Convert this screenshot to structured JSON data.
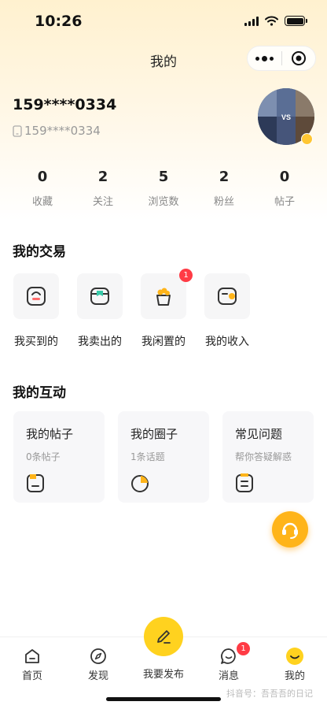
{
  "status": {
    "time": "10:26"
  },
  "nav": {
    "title": "我的"
  },
  "profile": {
    "phone_masked": "159****0334",
    "phone_sub": "159****0334"
  },
  "stats": [
    {
      "value": "0",
      "label": "收藏"
    },
    {
      "value": "2",
      "label": "关注"
    },
    {
      "value": "5",
      "label": "浏览数"
    },
    {
      "value": "2",
      "label": "粉丝"
    },
    {
      "value": "0",
      "label": "帖子"
    }
  ],
  "trade": {
    "title": "我的交易",
    "items": [
      {
        "label": "我买到的",
        "icon": "bought-icon"
      },
      {
        "label": "我卖出的",
        "icon": "sold-icon"
      },
      {
        "label": "我闲置的",
        "icon": "idle-icon",
        "badge": "1"
      },
      {
        "label": "我的收入",
        "icon": "income-icon"
      }
    ]
  },
  "interact": {
    "title": "我的互动",
    "cards": [
      {
        "title": "我的帖子",
        "sub": "0条帖子",
        "icon": "posts-icon"
      },
      {
        "title": "我的圈子",
        "sub": "1条话题",
        "icon": "circle-icon"
      },
      {
        "title": "常见问题",
        "sub": "帮你答疑解惑",
        "icon": "faq-icon"
      }
    ]
  },
  "tabbar": {
    "home": "首页",
    "discover": "发现",
    "publish": "我要发布",
    "messages": "消息",
    "messages_badge": "1",
    "mine": "我的"
  },
  "watermark": "抖音号：吾吾吾的日记",
  "colors": {
    "accent": "#ffc633",
    "badge": "#ff3b45",
    "fab": "#ffb419"
  }
}
